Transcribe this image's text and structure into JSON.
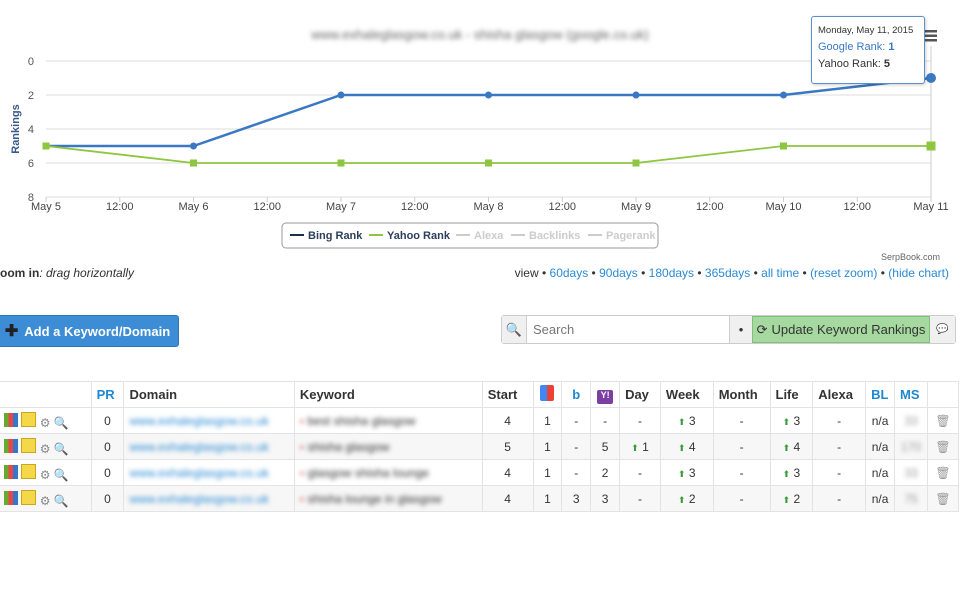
{
  "chart_data": {
    "type": "line",
    "title": "www.exhaleglasgow.co.uk - shisha glasgow (google.co.uk)",
    "ylabel": "Rankings",
    "ylim": [
      0,
      8
    ],
    "yticks": [
      0,
      2,
      4,
      6,
      8
    ],
    "yreversed": true,
    "x": [
      "May 5",
      "May 6",
      "May 7",
      "May 8",
      "May 9",
      "May 10",
      "May 11"
    ],
    "xticks": [
      "May 5",
      "12:00",
      "May 6",
      "12:00",
      "May 7",
      "12:00",
      "May 8",
      "12:00",
      "May 9",
      "12:00",
      "May 10",
      "12:00",
      "May 11"
    ],
    "series": [
      {
        "name": "Google Rank",
        "color": "#3a78c3",
        "values": [
          5,
          5,
          2,
          2,
          2,
          2,
          1
        ]
      },
      {
        "name": "Yahoo Rank",
        "color": "#8dc63f",
        "values": [
          5,
          6,
          6,
          6,
          6,
          5,
          5
        ]
      }
    ],
    "legend": [
      {
        "label": "Bing Rank",
        "color": "#1c2e4a",
        "active": true
      },
      {
        "label": "Yahoo Rank",
        "color": "#8dc63f",
        "active": true
      },
      {
        "label": "Alexa",
        "color": "#ccc",
        "active": false
      },
      {
        "label": "Backlinks",
        "color": "#ccc",
        "active": false
      },
      {
        "label": "Pagerank",
        "color": "#ccc",
        "active": false
      }
    ],
    "tooltip": {
      "date": "Monday, May 11, 2015",
      "line1_label": "Google Rank:",
      "line1_value": "1",
      "line2_label": "Yahoo Rank:",
      "line2_value": "5"
    },
    "credit": "SerpBook.com"
  },
  "zoom_hint": {
    "label": "oom in",
    "text": ": drag horizontally"
  },
  "view_links": {
    "label": "view",
    "items": [
      "60days",
      "90days",
      "180days",
      "365days",
      "all time",
      "(reset zoom)",
      "(hide chart)"
    ]
  },
  "add_button": "Add a Keyword/Domain",
  "search": {
    "placeholder": "Search",
    "dot": "•"
  },
  "update_button": "Update Keyword Rankings",
  "table": {
    "headers": [
      "",
      "PR",
      "Domain",
      "Keyword",
      "Start",
      "google-icon",
      "bing-icon",
      "yahoo-icon",
      "Day",
      "Week",
      "Month",
      "Life",
      "Alexa",
      "BL",
      "MS",
      ""
    ],
    "rows": [
      {
        "pr": "0",
        "domain": "www.exhaleglasgow.co.uk",
        "keyword": "best shisha glasgow",
        "start": "4",
        "g": "1",
        "b": "-",
        "y": "-",
        "day": "-",
        "day_up": false,
        "week": "3",
        "week_up": true,
        "month": "-",
        "life": "3",
        "life_up": true,
        "alexa": "-",
        "bl": "n/a",
        "ms": "33"
      },
      {
        "pr": "0",
        "domain": "www.exhaleglasgow.co.uk",
        "keyword": "shisha glasgow",
        "start": "5",
        "g": "1",
        "b": "-",
        "y": "5",
        "day": "1",
        "day_up": true,
        "week": "4",
        "week_up": true,
        "month": "-",
        "life": "4",
        "life_up": true,
        "alexa": "-",
        "bl": "n/a",
        "ms": "170"
      },
      {
        "pr": "0",
        "domain": "www.exhaleglasgow.co.uk",
        "keyword": "glasgow shisha lounge",
        "start": "4",
        "g": "1",
        "b": "-",
        "y": "2",
        "day": "-",
        "day_up": false,
        "week": "3",
        "week_up": true,
        "month": "-",
        "life": "3",
        "life_up": true,
        "alexa": "-",
        "bl": "n/a",
        "ms": "33"
      },
      {
        "pr": "0",
        "domain": "www.exhaleglasgow.co.uk",
        "keyword": "shisha lounge in glasgow",
        "start": "4",
        "g": "1",
        "b": "3",
        "y": "3",
        "day": "-",
        "day_up": false,
        "week": "2",
        "week_up": true,
        "month": "-",
        "life": "2",
        "life_up": true,
        "alexa": "-",
        "bl": "n/a",
        "ms": "75"
      }
    ]
  }
}
